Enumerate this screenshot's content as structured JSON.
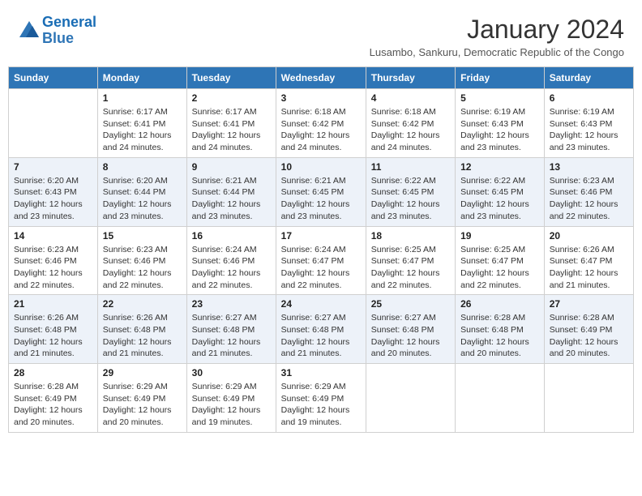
{
  "logo": {
    "line1": "General",
    "line2": "Blue"
  },
  "title": "January 2024",
  "subtitle": "Lusambo, Sankuru, Democratic Republic of the Congo",
  "days_of_week": [
    "Sunday",
    "Monday",
    "Tuesday",
    "Wednesday",
    "Thursday",
    "Friday",
    "Saturday"
  ],
  "weeks": [
    [
      {
        "day": "",
        "sunrise": "",
        "sunset": "",
        "daylight": ""
      },
      {
        "day": "1",
        "sunrise": "Sunrise: 6:17 AM",
        "sunset": "Sunset: 6:41 PM",
        "daylight": "Daylight: 12 hours and 24 minutes."
      },
      {
        "day": "2",
        "sunrise": "Sunrise: 6:17 AM",
        "sunset": "Sunset: 6:41 PM",
        "daylight": "Daylight: 12 hours and 24 minutes."
      },
      {
        "day": "3",
        "sunrise": "Sunrise: 6:18 AM",
        "sunset": "Sunset: 6:42 PM",
        "daylight": "Daylight: 12 hours and 24 minutes."
      },
      {
        "day": "4",
        "sunrise": "Sunrise: 6:18 AM",
        "sunset": "Sunset: 6:42 PM",
        "daylight": "Daylight: 12 hours and 24 minutes."
      },
      {
        "day": "5",
        "sunrise": "Sunrise: 6:19 AM",
        "sunset": "Sunset: 6:43 PM",
        "daylight": "Daylight: 12 hours and 23 minutes."
      },
      {
        "day": "6",
        "sunrise": "Sunrise: 6:19 AM",
        "sunset": "Sunset: 6:43 PM",
        "daylight": "Daylight: 12 hours and 23 minutes."
      }
    ],
    [
      {
        "day": "7",
        "sunrise": "Sunrise: 6:20 AM",
        "sunset": "Sunset: 6:43 PM",
        "daylight": "Daylight: 12 hours and 23 minutes."
      },
      {
        "day": "8",
        "sunrise": "Sunrise: 6:20 AM",
        "sunset": "Sunset: 6:44 PM",
        "daylight": "Daylight: 12 hours and 23 minutes."
      },
      {
        "day": "9",
        "sunrise": "Sunrise: 6:21 AM",
        "sunset": "Sunset: 6:44 PM",
        "daylight": "Daylight: 12 hours and 23 minutes."
      },
      {
        "day": "10",
        "sunrise": "Sunrise: 6:21 AM",
        "sunset": "Sunset: 6:45 PM",
        "daylight": "Daylight: 12 hours and 23 minutes."
      },
      {
        "day": "11",
        "sunrise": "Sunrise: 6:22 AM",
        "sunset": "Sunset: 6:45 PM",
        "daylight": "Daylight: 12 hours and 23 minutes."
      },
      {
        "day": "12",
        "sunrise": "Sunrise: 6:22 AM",
        "sunset": "Sunset: 6:45 PM",
        "daylight": "Daylight: 12 hours and 23 minutes."
      },
      {
        "day": "13",
        "sunrise": "Sunrise: 6:23 AM",
        "sunset": "Sunset: 6:46 PM",
        "daylight": "Daylight: 12 hours and 22 minutes."
      }
    ],
    [
      {
        "day": "14",
        "sunrise": "Sunrise: 6:23 AM",
        "sunset": "Sunset: 6:46 PM",
        "daylight": "Daylight: 12 hours and 22 minutes."
      },
      {
        "day": "15",
        "sunrise": "Sunrise: 6:23 AM",
        "sunset": "Sunset: 6:46 PM",
        "daylight": "Daylight: 12 hours and 22 minutes."
      },
      {
        "day": "16",
        "sunrise": "Sunrise: 6:24 AM",
        "sunset": "Sunset: 6:46 PM",
        "daylight": "Daylight: 12 hours and 22 minutes."
      },
      {
        "day": "17",
        "sunrise": "Sunrise: 6:24 AM",
        "sunset": "Sunset: 6:47 PM",
        "daylight": "Daylight: 12 hours and 22 minutes."
      },
      {
        "day": "18",
        "sunrise": "Sunrise: 6:25 AM",
        "sunset": "Sunset: 6:47 PM",
        "daylight": "Daylight: 12 hours and 22 minutes."
      },
      {
        "day": "19",
        "sunrise": "Sunrise: 6:25 AM",
        "sunset": "Sunset: 6:47 PM",
        "daylight": "Daylight: 12 hours and 22 minutes."
      },
      {
        "day": "20",
        "sunrise": "Sunrise: 6:26 AM",
        "sunset": "Sunset: 6:47 PM",
        "daylight": "Daylight: 12 hours and 21 minutes."
      }
    ],
    [
      {
        "day": "21",
        "sunrise": "Sunrise: 6:26 AM",
        "sunset": "Sunset: 6:48 PM",
        "daylight": "Daylight: 12 hours and 21 minutes."
      },
      {
        "day": "22",
        "sunrise": "Sunrise: 6:26 AM",
        "sunset": "Sunset: 6:48 PM",
        "daylight": "Daylight: 12 hours and 21 minutes."
      },
      {
        "day": "23",
        "sunrise": "Sunrise: 6:27 AM",
        "sunset": "Sunset: 6:48 PM",
        "daylight": "Daylight: 12 hours and 21 minutes."
      },
      {
        "day": "24",
        "sunrise": "Sunrise: 6:27 AM",
        "sunset": "Sunset: 6:48 PM",
        "daylight": "Daylight: 12 hours and 21 minutes."
      },
      {
        "day": "25",
        "sunrise": "Sunrise: 6:27 AM",
        "sunset": "Sunset: 6:48 PM",
        "daylight": "Daylight: 12 hours and 20 minutes."
      },
      {
        "day": "26",
        "sunrise": "Sunrise: 6:28 AM",
        "sunset": "Sunset: 6:48 PM",
        "daylight": "Daylight: 12 hours and 20 minutes."
      },
      {
        "day": "27",
        "sunrise": "Sunrise: 6:28 AM",
        "sunset": "Sunset: 6:49 PM",
        "daylight": "Daylight: 12 hours and 20 minutes."
      }
    ],
    [
      {
        "day": "28",
        "sunrise": "Sunrise: 6:28 AM",
        "sunset": "Sunset: 6:49 PM",
        "daylight": "Daylight: 12 hours and 20 minutes."
      },
      {
        "day": "29",
        "sunrise": "Sunrise: 6:29 AM",
        "sunset": "Sunset: 6:49 PM",
        "daylight": "Daylight: 12 hours and 20 minutes."
      },
      {
        "day": "30",
        "sunrise": "Sunrise: 6:29 AM",
        "sunset": "Sunset: 6:49 PM",
        "daylight": "Daylight: 12 hours and 19 minutes."
      },
      {
        "day": "31",
        "sunrise": "Sunrise: 6:29 AM",
        "sunset": "Sunset: 6:49 PM",
        "daylight": "Daylight: 12 hours and 19 minutes."
      },
      {
        "day": "",
        "sunrise": "",
        "sunset": "",
        "daylight": ""
      },
      {
        "day": "",
        "sunrise": "",
        "sunset": "",
        "daylight": ""
      },
      {
        "day": "",
        "sunrise": "",
        "sunset": "",
        "daylight": ""
      }
    ]
  ]
}
